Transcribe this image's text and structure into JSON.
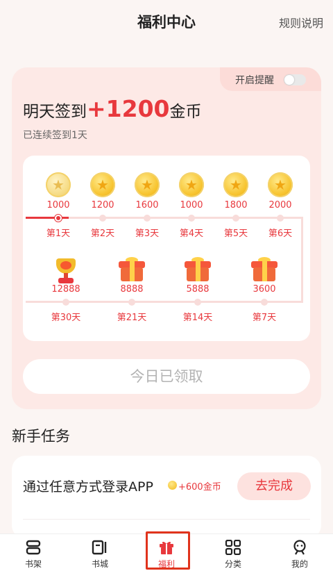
{
  "header": {
    "title": "福利中心",
    "rules": "规则说明"
  },
  "checkin": {
    "remind_label": "开启提醒",
    "remind_on": false,
    "tomorrow_prefix": "明天签到",
    "tomorrow_amount": "+1200",
    "tomorrow_suffix": "金币",
    "streak": "已连续签到1天",
    "row1": [
      {
        "reward": "1000",
        "day": "第1天",
        "icon": "coin-icon",
        "claimed": true
      },
      {
        "reward": "1200",
        "day": "第2天",
        "icon": "coin-icon"
      },
      {
        "reward": "1600",
        "day": "第3天",
        "icon": "coin-icon"
      },
      {
        "reward": "1000",
        "day": "第4天",
        "icon": "coin-icon"
      },
      {
        "reward": "1800",
        "day": "第5天",
        "icon": "coin-icon"
      },
      {
        "reward": "2000",
        "day": "第6天",
        "icon": "coin-icon"
      }
    ],
    "row2": [
      {
        "reward": "12888",
        "day": "第30天",
        "icon": "trophy-icon"
      },
      {
        "reward": "8888",
        "day": "第21天",
        "icon": "gift-icon"
      },
      {
        "reward": "5888",
        "day": "第14天",
        "icon": "gift-icon"
      },
      {
        "reward": "3600",
        "day": "第7天",
        "icon": "gift-icon"
      }
    ],
    "claim_button": "今日已领取"
  },
  "tasks": {
    "title": "新手任务",
    "items": [
      {
        "name": "通过任意方式登录APP",
        "reward": "+600金币",
        "button": "去完成"
      }
    ]
  },
  "tabbar": [
    {
      "label": "书架",
      "icon": "bookshelf-icon"
    },
    {
      "label": "书城",
      "icon": "bookstore-icon"
    },
    {
      "label": "福利",
      "icon": "gift-icon",
      "active": true
    },
    {
      "label": "分类",
      "icon": "category-grid-icon"
    },
    {
      "label": "我的",
      "icon": "profile-icon"
    }
  ],
  "colors": {
    "accent": "#e8383d",
    "background": "#fbf5f3",
    "card": "#fde9e6"
  }
}
